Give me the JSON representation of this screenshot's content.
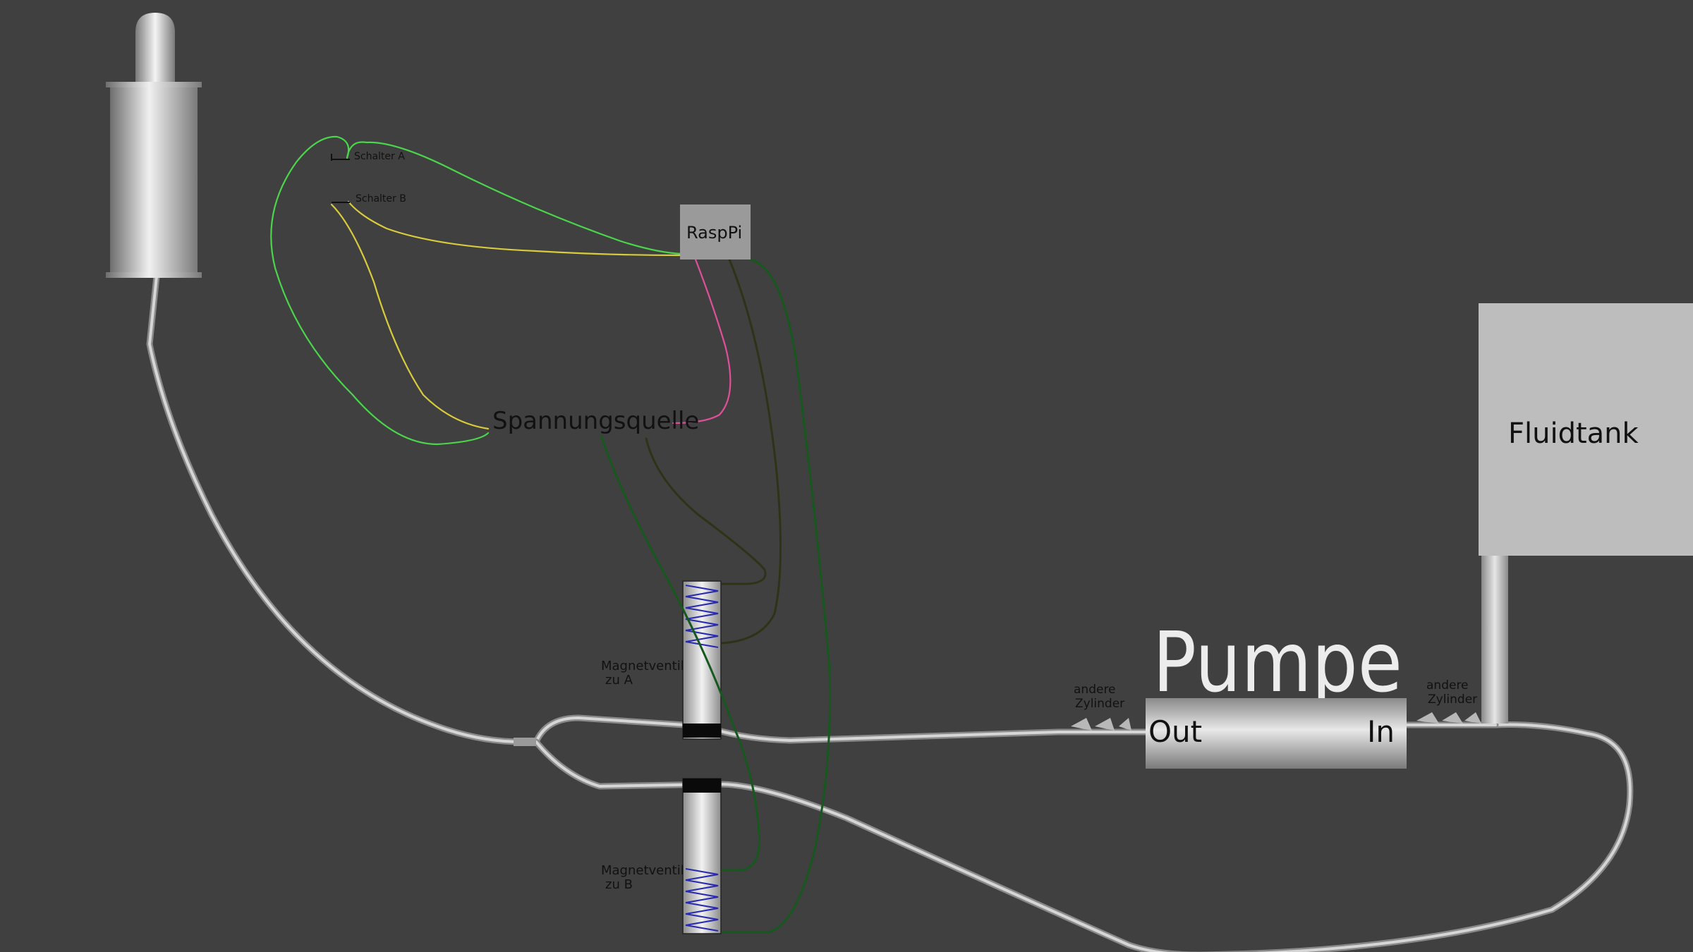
{
  "labels": {
    "switch_a": "Schalter A",
    "switch_b": "Schalter B",
    "raspi": "RaspPi",
    "power_source": "Spannungsquelle",
    "fluid_tank": "Fluidtank",
    "pump_title": "Pumpe",
    "pump_out": "Out",
    "pump_in": "In",
    "valve_a_line1": "Magnetventil",
    "valve_a_line2": "zu A",
    "valve_b_line1": "Magnetventil",
    "valve_b_line2": "zu B",
    "other_cyl_left_line1": "andere",
    "other_cyl_left_line2": "Zylinder",
    "other_cyl_right_line1": "andere",
    "other_cyl_right_line2": "Zylinder"
  },
  "colors": {
    "background": "#404040",
    "wire_green": "#4bd54b",
    "wire_yellow": "#d8cc3c",
    "wire_pink": "#e0509a",
    "wire_olive": "#2e3318",
    "wire_darkgreen": "#16581e",
    "spring": "#2a2ab0",
    "box_gray": "#9a9a9a",
    "tank_gray": "#bdbdbd"
  }
}
